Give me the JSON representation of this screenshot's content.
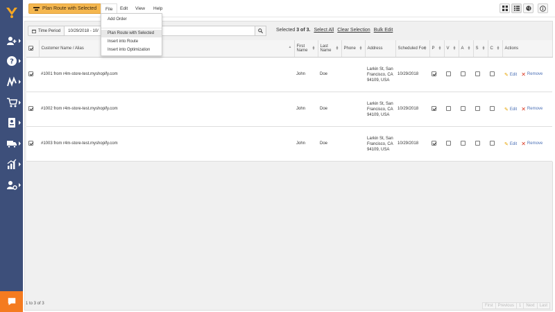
{
  "toolbar": {
    "plan_button_label": "Plan Route with Selected",
    "menus": [
      "File",
      "Edit",
      "View",
      "Help"
    ]
  },
  "file_menu": {
    "items": [
      "Add Order",
      "Plan Route with Selected",
      "Insert into Route",
      "Insert into Optimization"
    ]
  },
  "filter": {
    "label": "Time Period",
    "value": "10/29/2018 - 10/",
    "selected_prefix": "Selected",
    "selected_count": "3 of 3.",
    "select_all": "Select All",
    "clear_selection": "Clear Selection",
    "bulk_edit": "Bulk Edit"
  },
  "table": {
    "headers": {
      "customer": "Customer Name / Alias",
      "first": "First Name",
      "last": "Last Name",
      "phone": "Phone",
      "address": "Address",
      "scheduled": "Scheduled For",
      "p": "P",
      "v": "V",
      "a": "A",
      "s": "S",
      "c": "C",
      "actions": "Actions"
    },
    "rows": [
      {
        "customer": "#1001 from r4m-store-test.myshopify.com",
        "first": "John",
        "last": "Doe",
        "phone": "",
        "address": "Larkin St, San Francisco, CA 94109, USA",
        "scheduled": "10/29/2018"
      },
      {
        "customer": "#1002 from r4m-store-test.myshopify.com",
        "first": "John",
        "last": "Doe",
        "phone": "",
        "address": "Larkin St, San Francisco, CA 94109, USA",
        "scheduled": "10/29/2018"
      },
      {
        "customer": "#1003 from r4m-store-test.myshopify.com",
        "first": "John",
        "last": "Doe",
        "phone": "",
        "address": "Larkin St, San Francisco, CA 94109, USA",
        "scheduled": "10/29/2018"
      }
    ],
    "edit_label": "Edit",
    "remove_label": "Remove"
  },
  "footer": {
    "count": "1 to 3 of 3",
    "pager": [
      "First",
      "Previous",
      "1",
      "Next",
      "Last"
    ]
  },
  "colors": {
    "sidebar": "#3d4f7a",
    "accent": "#f5b74f",
    "chat": "#f47b20",
    "link": "#4a6fb5",
    "remove": "#d9321b"
  }
}
